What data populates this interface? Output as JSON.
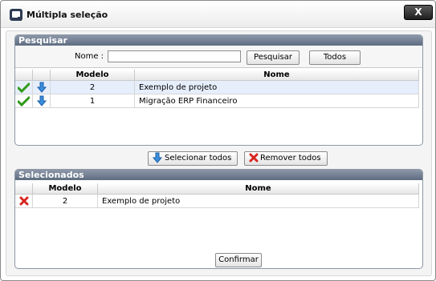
{
  "window": {
    "title": "Múltipla seleção",
    "close_label": "X"
  },
  "search_panel": {
    "header": "Pesquisar",
    "name_label": "Nome :",
    "name_value": "",
    "search_button": "Pesquisar",
    "all_button": "Todos",
    "columns": [
      "Modelo",
      "Nome"
    ],
    "rows": [
      {
        "modelo": "2",
        "nome": "Exemplo de projeto",
        "selected": true
      },
      {
        "modelo": "1",
        "nome": "Migração ERP Financeiro",
        "selected": false
      }
    ]
  },
  "actions": {
    "select_all": "Selecionar todos",
    "remove_all": "Remover todos"
  },
  "selected_panel": {
    "header": "Selecionados",
    "columns": [
      "Modelo",
      "Nome"
    ],
    "rows": [
      {
        "modelo": "2",
        "nome": "Exemplo de projeto"
      }
    ],
    "confirm_button": "Confirmar"
  },
  "colors": {
    "header_dark": "#5f6c80",
    "header_light": "#8c98a9",
    "row_selected": "#e6eefc"
  }
}
